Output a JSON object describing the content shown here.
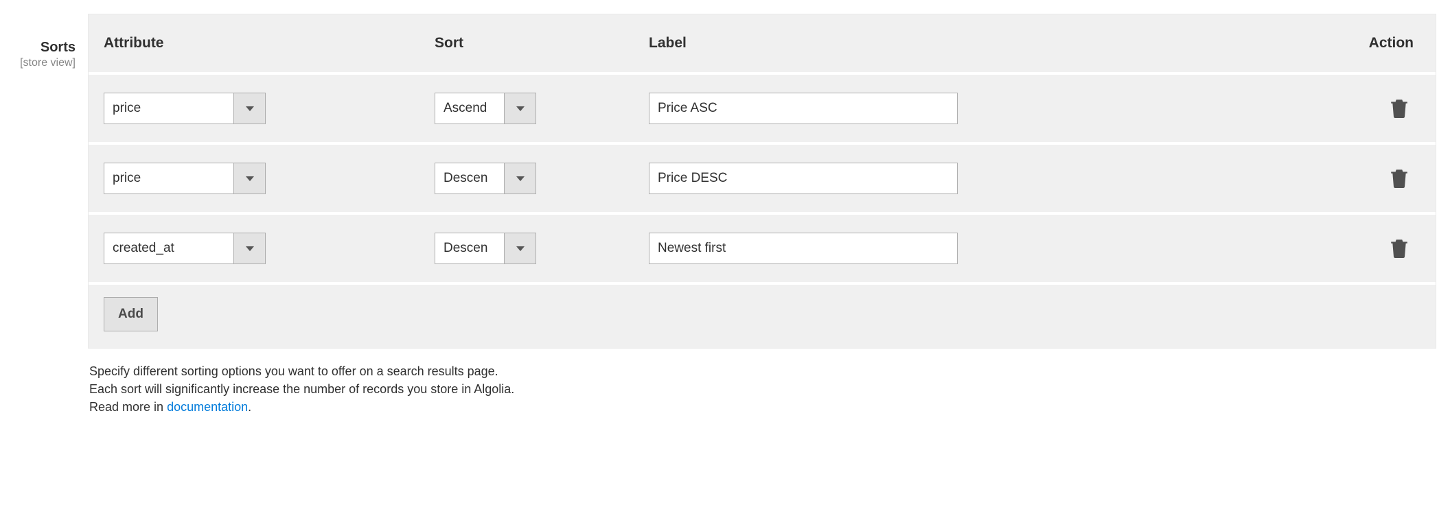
{
  "sideLabel": {
    "title": "Sorts",
    "scope": "[store view]"
  },
  "headers": {
    "attribute": "Attribute",
    "sort": "Sort",
    "label": "Label",
    "action": "Action"
  },
  "rows": [
    {
      "attribute": "price",
      "sort": "Ascend",
      "label": "Price ASC"
    },
    {
      "attribute": "price",
      "sort": "Descen",
      "label": "Price DESC"
    },
    {
      "attribute": "created_at",
      "sort": "Descen",
      "label": "Newest first"
    }
  ],
  "addButton": "Add",
  "help": {
    "line1": "Specify different sorting options you want to offer on a search results page.",
    "line2": "Each sort will significantly increase the number of records you store in Algolia.",
    "readMorePrefix": "Read more in ",
    "linkText": "documentation",
    "period": "."
  }
}
